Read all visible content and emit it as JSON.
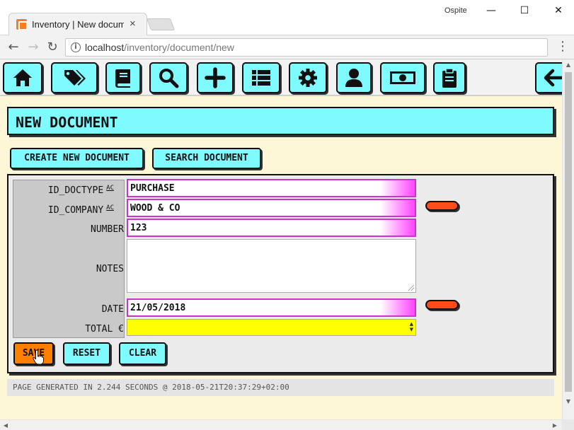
{
  "browser": {
    "tab_title": "Inventory | New document",
    "tab_close": "×",
    "profile": "Ospite",
    "window_controls": {
      "minimize": "—",
      "maximize": "☐",
      "close": "✕"
    },
    "nav": {
      "back": "←",
      "forward": "→",
      "reload": "↻",
      "menu": "⋮"
    },
    "url_host": "localhost",
    "url_path": "/inventory/document/new"
  },
  "iconbar": {
    "items": [
      {
        "name": "home-icon"
      },
      {
        "name": "tags-icon"
      },
      {
        "name": "book-icon"
      },
      {
        "name": "search-icon"
      },
      {
        "name": "plus-icon"
      },
      {
        "name": "list-icon"
      },
      {
        "name": "gear-icon"
      },
      {
        "name": "user-icon"
      },
      {
        "name": "money-icon"
      },
      {
        "name": "clipboard-icon"
      },
      {
        "name": "arrow-left-icon"
      }
    ]
  },
  "page": {
    "title": "NEW DOCUMENT",
    "tabs": {
      "create": "CREATE NEW DOCUMENT",
      "search": "SEARCH DOCUMENT"
    }
  },
  "form": {
    "ac_marker": "AC",
    "labels": {
      "doctype": "ID_DOCTYPE",
      "company": "ID_COMPANY",
      "number": "NUMBER",
      "notes": "NOTES",
      "date": "DATE",
      "total": "TOTAL €"
    },
    "values": {
      "doctype": "PURCHASE",
      "company": "WOOD & CO",
      "number": "123",
      "notes": "",
      "date": "21/05/2018",
      "total": ""
    },
    "actions": {
      "save": "SAVE",
      "reset": "RESET",
      "clear": "CLEAR"
    }
  },
  "footer": {
    "text": "PAGE GENERATED IN 2.244 SECONDS @ 2018-05-21T20:37:29+02:00"
  },
  "colors": {
    "accent": "#7ffbff",
    "save": "#ff8000",
    "pill": "#ff4a1a",
    "field_border": "#cc33cc",
    "total_bg": "#ffff00",
    "page_bg": "#fdf7d8"
  }
}
